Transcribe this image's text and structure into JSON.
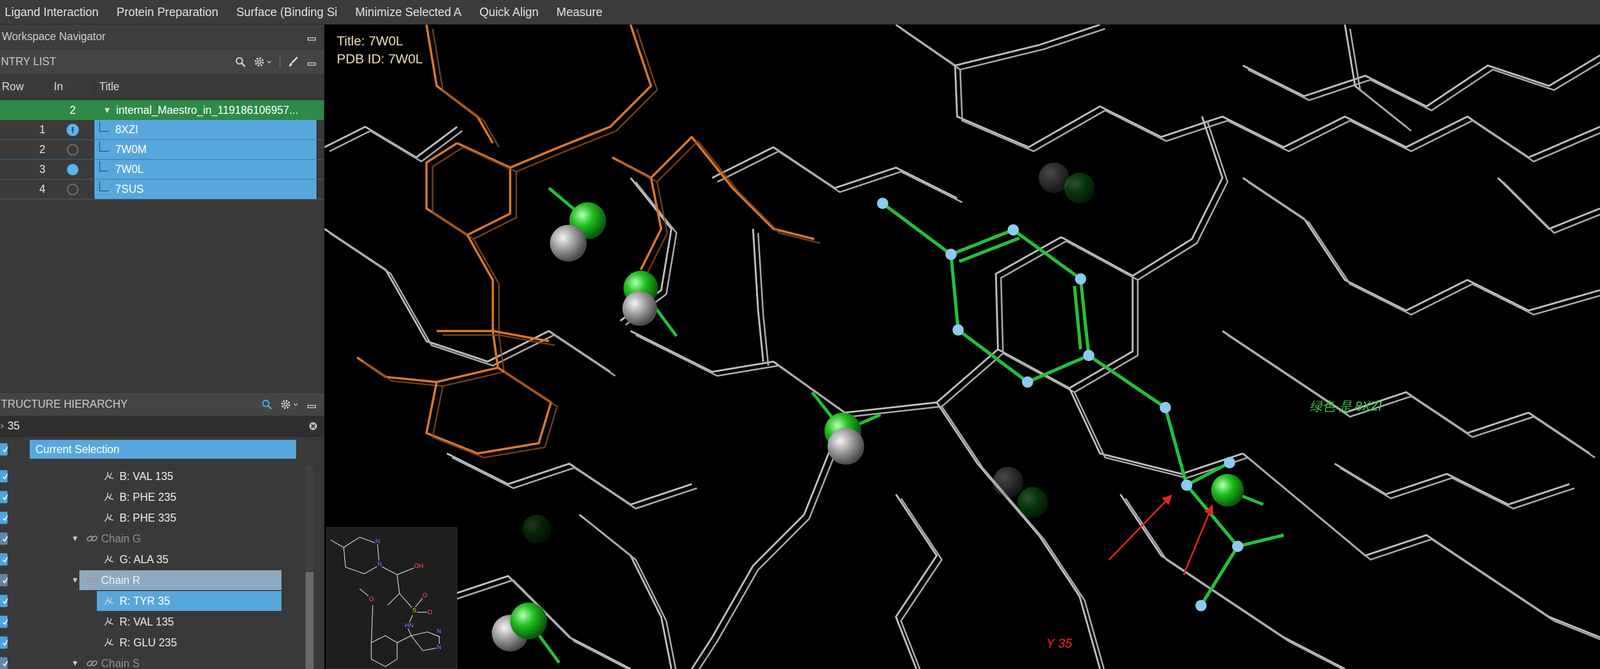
{
  "menu": [
    "Ligand Interaction",
    "Protein Preparation",
    "Surface (Binding Si",
    "Minimize Selected A",
    "Quick Align",
    "Measure"
  ],
  "navigator": {
    "title": "Workspace Navigator"
  },
  "entry_list": {
    "title": "NTRY LIST",
    "columns": [
      "Row",
      "In",
      "Title"
    ],
    "group": {
      "count": "2",
      "expander": "▼",
      "title": "internal_Maestro_in_119186106957...",
      "expanded": true,
      "selected": true
    },
    "rows": [
      {
        "row": "1",
        "title": "8XZI",
        "in": "fixed",
        "selected": true
      },
      {
        "row": "2",
        "title": "7W0M",
        "in": "excluded",
        "selected": true
      },
      {
        "row": "3",
        "title": "7W0L",
        "in": "included",
        "selected": true
      },
      {
        "row": "4",
        "title": "7SUS",
        "in": "excluded",
        "selected": true
      }
    ]
  },
  "hierarchy": {
    "title": "TRUCTURE HIERARCHY",
    "search": {
      "value": "35"
    },
    "current_selection": {
      "label": "Current Selection",
      "checked": true,
      "selected": true
    },
    "items": [
      {
        "label": "B: VAL 135",
        "kind": "residue",
        "checked": true,
        "selected": false
      },
      {
        "label": "B: PHE 235",
        "kind": "residue",
        "checked": true,
        "selected": false
      },
      {
        "label": "B: PHE 335",
        "kind": "residue",
        "checked": true,
        "selected": false
      },
      {
        "label": "Chain G",
        "kind": "chain",
        "expander": "▼",
        "expanded": true,
        "checked": true,
        "selected": false
      },
      {
        "label": "G: ALA 35",
        "kind": "residue",
        "checked": true,
        "selected": false
      },
      {
        "label": "Chain R",
        "kind": "chain",
        "expander": "▼",
        "expanded": true,
        "checked": true,
        "selected": true
      },
      {
        "label": "R: TYR 35",
        "kind": "residue",
        "checked": true,
        "selected": true
      },
      {
        "label": "R: VAL 135",
        "kind": "residue",
        "checked": true,
        "selected": false
      },
      {
        "label": "R: GLU 235",
        "kind": "residue",
        "checked": true,
        "selected": false
      },
      {
        "label": "Chain S",
        "kind": "chain",
        "expander": "▼",
        "expanded": true,
        "checked": true,
        "selected": false
      }
    ]
  },
  "viewer": {
    "title": "Title: 7W0L",
    "pdb_id": "PDB ID: 7W0L",
    "annotations": [
      {
        "text": "绿色 是 8XZI",
        "color": "#3cc84a"
      },
      {
        "text": "Y 35",
        "color": "#e02424"
      }
    ],
    "inset": {
      "labels": [
        {
          "text": "N",
          "color": "#6f7dff"
        },
        {
          "text": "N",
          "color": "#6f7dff"
        },
        {
          "text": "OH",
          "color": "#ff4a4a"
        },
        {
          "text": "O",
          "color": "#ff4a4a"
        },
        {
          "text": "S",
          "color": "#e0c020"
        },
        {
          "text": "O",
          "color": "#ff4a4a"
        },
        {
          "text": "O",
          "color": "#ff4a4a"
        },
        {
          "text": "HN",
          "color": "#6f7dff"
        },
        {
          "text": "N",
          "color": "#6f7dff"
        },
        {
          "text": "N",
          "color": "#6f7dff"
        }
      ]
    }
  }
}
